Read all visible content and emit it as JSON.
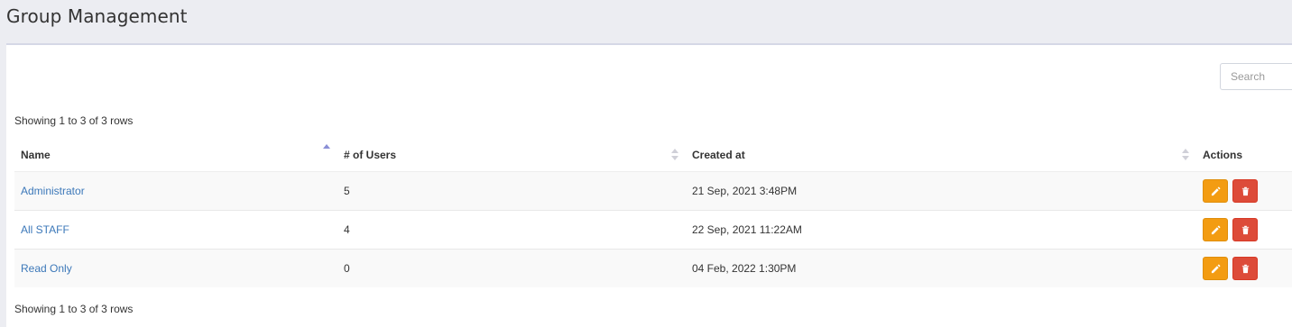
{
  "header": {
    "title": "Group Management"
  },
  "search": {
    "placeholder": "Search"
  },
  "pagination": {
    "info_top": "Showing 1 to 3 of 3 rows",
    "info_bottom": "Showing 1 to 3 of 3 rows"
  },
  "table": {
    "columns": [
      {
        "label": "Name",
        "sort": "asc"
      },
      {
        "label": "# of Users",
        "sort": "none"
      },
      {
        "label": "Created at",
        "sort": "none"
      },
      {
        "label": "Actions"
      }
    ],
    "rows": [
      {
        "name": "Administrator",
        "users": "5",
        "created": "21 Sep, 2021 3:48PM"
      },
      {
        "name": "All STAFF",
        "users": "4",
        "created": "22 Sep, 2021 11:22AM"
      },
      {
        "name": "Read Only",
        "users": "0",
        "created": "04 Feb, 2022 1:30PM"
      }
    ]
  },
  "icons": {
    "edit": "pencil-icon",
    "delete": "trash-icon"
  },
  "colors": {
    "link": "#3c78b9",
    "edit_button": "#f39c12",
    "delete_button": "#dd4b39",
    "sort_active": "#8a8fd6"
  }
}
